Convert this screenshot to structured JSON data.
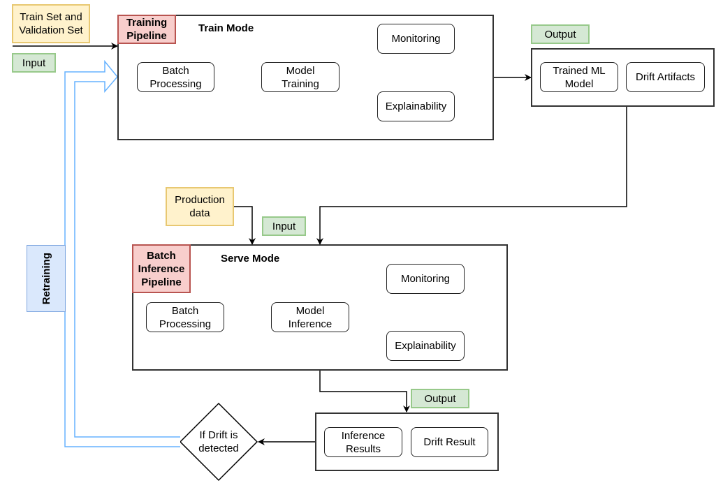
{
  "train_section": {
    "input_source": "Train Set and Validation Set",
    "input_label": "Input",
    "pipeline_tag": "Training Pipeline",
    "mode_title": "Train Mode",
    "steps": {
      "batch_processing": "Batch Processing",
      "model_training": "Model Training",
      "monitoring": "Monitoring",
      "explainability": "Explainability"
    },
    "output_label": "Output",
    "outputs": [
      "Trained ML Model",
      "Drift Artifacts"
    ]
  },
  "serve_section": {
    "input_source": "Production data",
    "input_label": "Input",
    "pipeline_tag": "Batch Inference Pipeline",
    "mode_title": "Serve Mode",
    "steps": {
      "batch_processing": "Batch Processing",
      "model_inference": "Model Inference",
      "monitoring": "Monitoring",
      "explainability": "Explainability"
    },
    "output_label": "Output",
    "outputs": [
      "Inference Results",
      "Drift Result"
    ]
  },
  "decision": {
    "label": "If Drift is detected"
  },
  "feedback": {
    "label": "Retraining"
  },
  "colors": {
    "data_source": "#fff2cc",
    "io_label": "#d5e8d4",
    "pipeline_tag": "#f8cecc",
    "retraining": "#dae8fc",
    "feedback_arrow": "#66b2ff"
  }
}
